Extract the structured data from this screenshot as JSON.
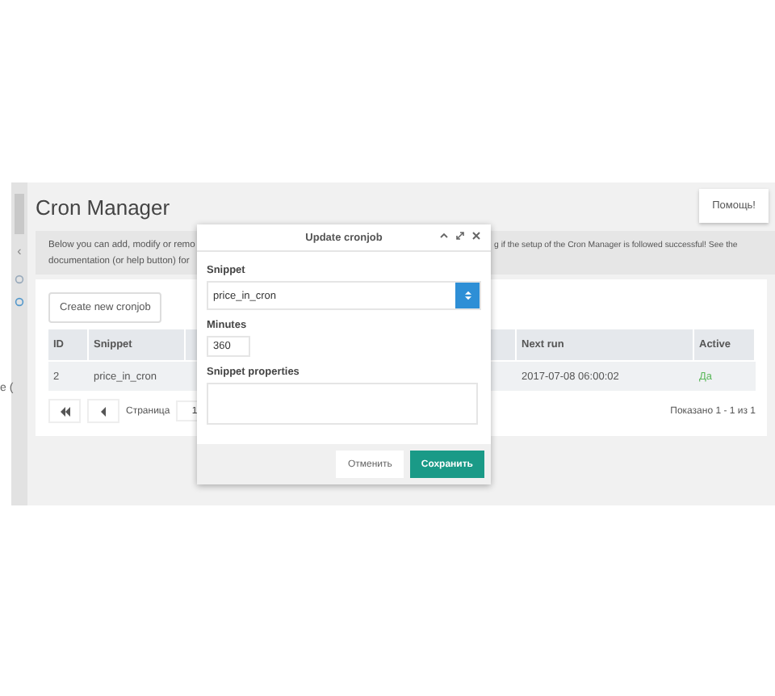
{
  "sidebar": {
    "collapse_glyph": "‹",
    "fragment": "e ("
  },
  "header": {
    "title": "Cron Manager",
    "help_button": "Помощь!"
  },
  "description": {
    "left_lines": [
      "Below you can add, modify or remo",
      "documentation (or help button) for"
    ],
    "right_line": "g if the setup of the Cron Manager is followed successful! See the"
  },
  "create_button": "Create new cronjob",
  "table": {
    "columns": [
      {
        "label": "ID",
        "kind": "id"
      },
      {
        "label": "Snippet",
        "kind": "snippet"
      },
      {
        "label": "Next run",
        "kind": "next"
      },
      {
        "label": "Active",
        "kind": "active"
      }
    ],
    "rows": [
      {
        "id": "2",
        "snippet": "price_in_cron",
        "next_run": "2017-07-08 06:00:02",
        "active": "Да",
        "color": "#5cb85c"
      }
    ]
  },
  "pagination": {
    "page_label": "Страница",
    "page_value": "1",
    "summary": "Показано 1 - 1 из 1"
  },
  "modal": {
    "title": "Update cronjob",
    "snippet_label": "Snippet",
    "snippet_value": "price_in_cron",
    "minutes_label": "Minutes",
    "minutes_value": "360",
    "properties_label": "Snippet properties",
    "cancel_button": "Отменить",
    "save_button": "Сохранить"
  }
}
